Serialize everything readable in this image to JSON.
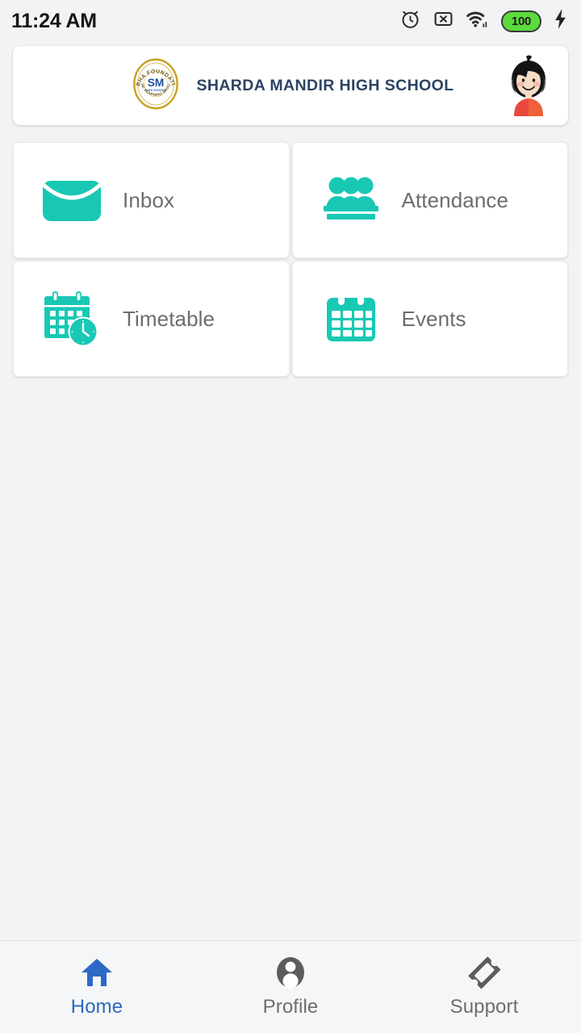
{
  "status_bar": {
    "time": "11:24 AM",
    "icons": [
      "alarm-icon",
      "x-box-icon",
      "wifi-icon",
      "battery-icon",
      "charging-bolt-icon"
    ],
    "battery_level": "100",
    "battery_color": "#5BDB3C"
  },
  "header": {
    "school_name": "SHARDA MANDIR HIGH SCHOOL",
    "logo": {
      "top_arc_text": "LODHA FOUNDATION",
      "bottom_arc_text": "THE LEARNING GROUP",
      "monogram": "SM",
      "sub_monogram": "HIGH SCHOOL",
      "ring_color": "#C9A227",
      "monogram_color": "#1F4E9C"
    },
    "avatar": "student-avatar",
    "title_color": "#2B4464"
  },
  "menu": {
    "accent_color": "#19C8B4",
    "items": [
      {
        "label": "Inbox",
        "icon": "envelope-icon",
        "name": "inbox"
      },
      {
        "label": "Attendance",
        "icon": "people-group-icon",
        "name": "attendance"
      },
      {
        "label": "Timetable",
        "icon": "calendar-clock-icon",
        "name": "timetable"
      },
      {
        "label": "Events",
        "icon": "calendar-icon",
        "name": "events"
      }
    ]
  },
  "bottom_nav": {
    "active_color": "#2D68C4",
    "inactive_color": "#6E6E6E",
    "items": [
      {
        "label": "Home",
        "icon": "home-icon",
        "active": true
      },
      {
        "label": "Profile",
        "icon": "person-circle-icon",
        "active": false
      },
      {
        "label": "Support",
        "icon": "ticket-icon",
        "active": false
      }
    ]
  }
}
